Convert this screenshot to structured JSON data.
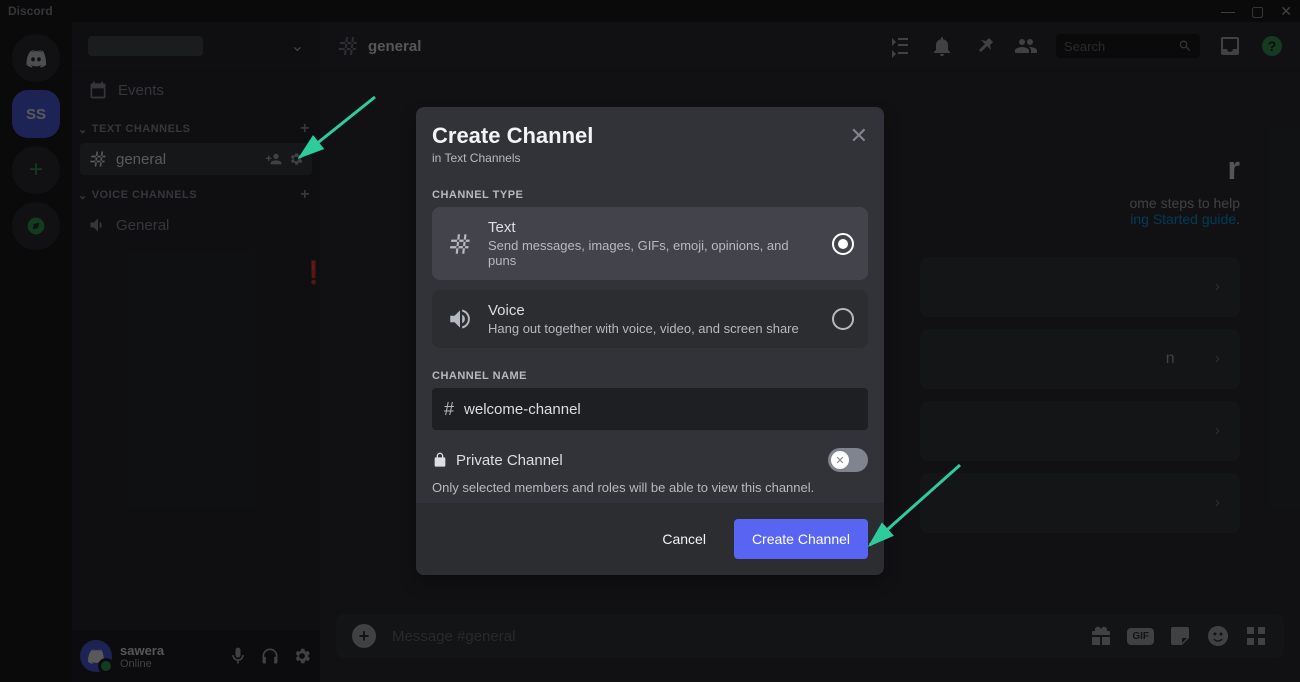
{
  "titlebar": {
    "app": "Discord"
  },
  "server_icons": {
    "ss_label": "SS"
  },
  "sidebar": {
    "events": "Events",
    "text_category": "TEXT CHANNELS",
    "voice_category": "VOICE CHANNELS",
    "text_channels": [
      "general"
    ],
    "voice_channels": [
      "General"
    ]
  },
  "user": {
    "name": "sawera",
    "status": "Online"
  },
  "header": {
    "channel": "general",
    "search_placeholder": "Search"
  },
  "welcome": {
    "title_fragment": "r",
    "desc_l1": "ome steps to help",
    "desc_l2": "ing Started guide"
  },
  "message_input": {
    "placeholder": "Message #general",
    "gif": "GIF"
  },
  "modal": {
    "title": "Create Channel",
    "subtitle": "in Text Channels",
    "type_label": "CHANNEL TYPE",
    "text": {
      "title": "Text",
      "desc": "Send messages, images, GIFs, emoji, opinions, and puns"
    },
    "voice": {
      "title": "Voice",
      "desc": "Hang out together with voice, video, and screen share"
    },
    "name_label": "CHANNEL NAME",
    "name_value": "welcome-channel",
    "private_label": "Private Channel",
    "private_desc": "Only selected members and roles will be able to view this channel.",
    "cancel": "Cancel",
    "create": "Create Channel"
  }
}
